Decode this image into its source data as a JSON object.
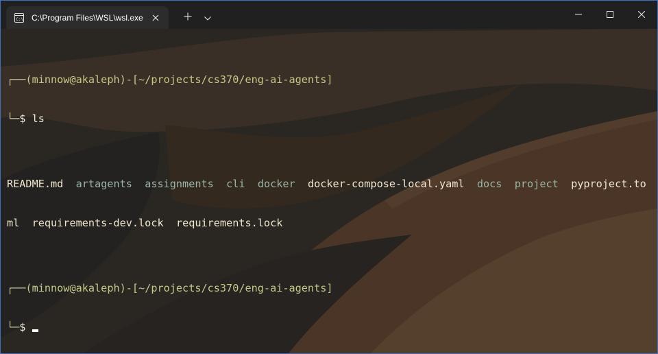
{
  "window": {
    "tab_title": "C:\\Program Files\\WSL\\wsl.exe",
    "icons": {
      "tab": "terminal-icon",
      "close_tab": "close-icon",
      "new_tab": "plus-icon",
      "dropdown": "chevron-down-icon",
      "minimize": "minimize-icon",
      "maximize": "maximize-icon",
      "close": "close-icon"
    }
  },
  "terminal": {
    "prompt1": {
      "top_corner": "┌──",
      "open_paren": "(",
      "user_host": "minnow@akaleph",
      "close_paren_dash": ")-[",
      "path": "~/projects/cs370/eng-ai-agents",
      "close_bracket": "]",
      "bottom_corner": "└─",
      "dollar": "$",
      "command": "ls"
    },
    "listing_line1": [
      {
        "name": "README.md",
        "type": "file"
      },
      {
        "name": "artagents",
        "type": "dir"
      },
      {
        "name": "assignments",
        "type": "dir"
      },
      {
        "name": "cli",
        "type": "dir"
      },
      {
        "name": "docker",
        "type": "dir"
      },
      {
        "name": "docker-compose-local.yaml",
        "type": "file"
      },
      {
        "name": "docs",
        "type": "dir"
      },
      {
        "name": "project",
        "type": "dir"
      },
      {
        "name": "pyproject.to",
        "type": "file"
      }
    ],
    "listing_line2": [
      {
        "name": "ml",
        "type": "file"
      },
      {
        "name": "requirements-dev.lock",
        "type": "file"
      },
      {
        "name": "requirements.lock",
        "type": "file"
      }
    ],
    "prompt2": {
      "top_corner": "┌──",
      "open_paren": "(",
      "user_host": "minnow@akaleph",
      "close_paren_dash": ")-[",
      "path": "~/projects/cs370/eng-ai-agents",
      "close_bracket": "]",
      "bottom_corner": "└─",
      "dollar": "$",
      "command": ""
    }
  },
  "colors": {
    "titlebar": "#202020",
    "tab": "#2c2c2c",
    "prompt": "#c5c987",
    "file": "#f0e6cf",
    "directory": "#9ab5a7"
  }
}
